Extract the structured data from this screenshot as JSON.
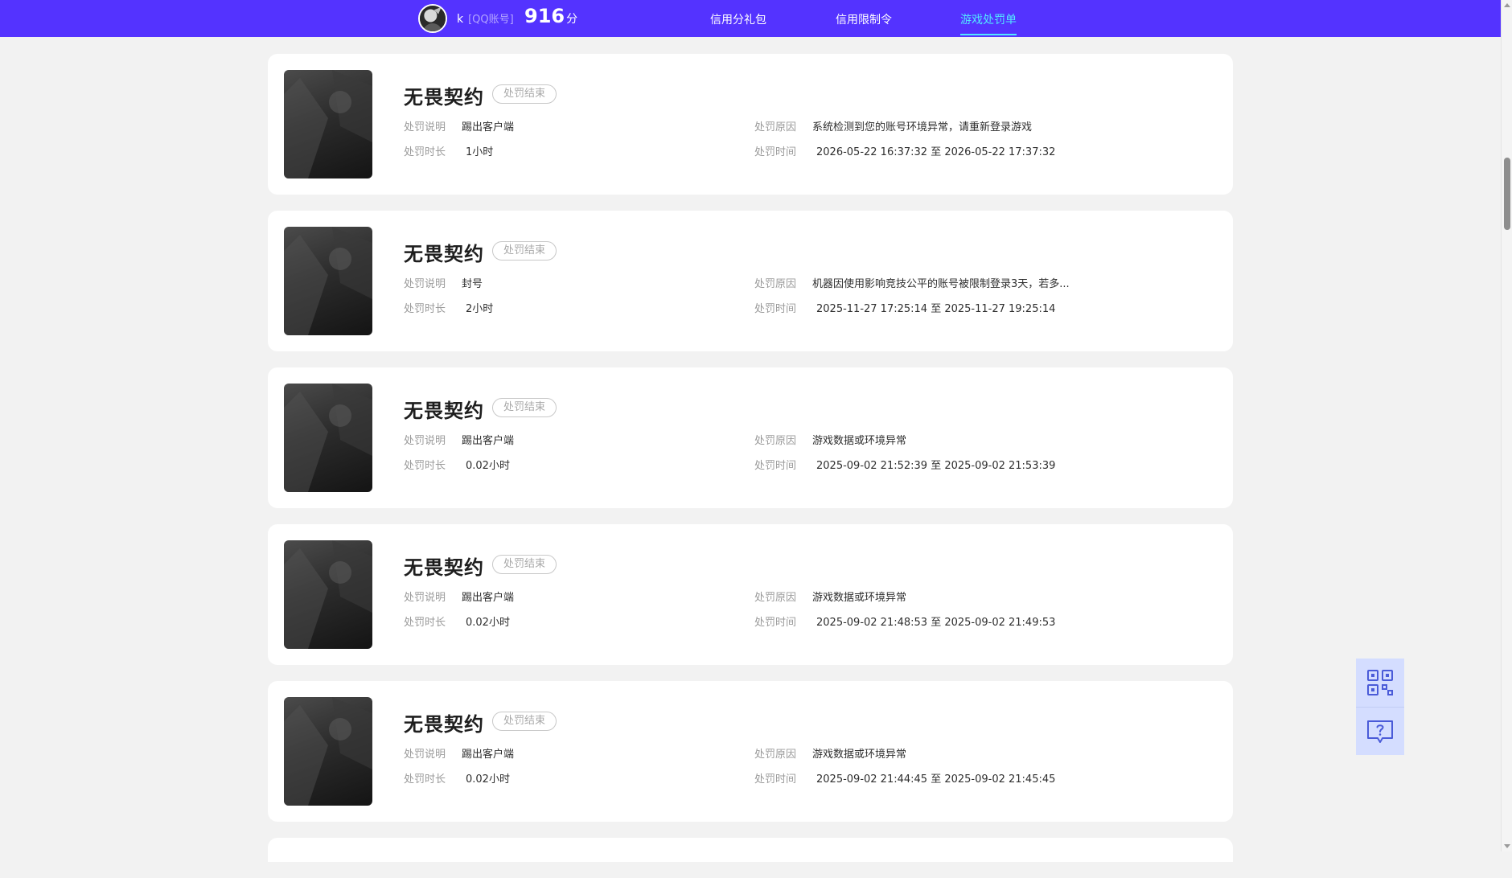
{
  "header": {
    "username": "k",
    "account_type": "[QQ账号]",
    "score": "916",
    "score_unit": "分",
    "tabs": [
      {
        "label": "信用分礼包",
        "active": false
      },
      {
        "label": "信用限制令",
        "active": false
      },
      {
        "label": "游戏处罚单",
        "active": true
      }
    ]
  },
  "labels": {
    "desc": "处罚说明",
    "duration": "处罚时长",
    "reason": "处罚原因",
    "time": "处罚时间"
  },
  "records": [
    {
      "game": "无畏契约",
      "status": "处罚结束",
      "desc": "踢出客户端",
      "duration": "1小时",
      "reason": "系统检测到您的账号环境异常，请重新登录游戏",
      "time": "2026-05-22 16:37:32 至 2026-05-22 17:37:32"
    },
    {
      "game": "无畏契约",
      "status": "处罚结束",
      "desc": "封号",
      "duration": "2小时",
      "reason": "机器因使用影响竞技公平的账号被限制登录3天，若多...",
      "time": "2025-11-27 17:25:14 至 2025-11-27 19:25:14"
    },
    {
      "game": "无畏契约",
      "status": "处罚结束",
      "desc": "踢出客户端",
      "duration": "0.02小时",
      "reason": "游戏数据或环境异常",
      "time": "2025-09-02 21:52:39 至 2025-09-02 21:53:39"
    },
    {
      "game": "无畏契约",
      "status": "处罚结束",
      "desc": "踢出客户端",
      "duration": "0.02小时",
      "reason": "游戏数据或环境异常",
      "time": "2025-09-02 21:48:53 至 2025-09-02 21:49:53"
    },
    {
      "game": "无畏契约",
      "status": "处罚结束",
      "desc": "踢出客户端",
      "duration": "0.02小时",
      "reason": "游戏数据或环境异常",
      "time": "2025-09-02 21:44:45 至 2025-09-02 21:45:45"
    }
  ],
  "floating_buttons": [
    {
      "icon": "qr-code-icon"
    },
    {
      "icon": "feedback-help-icon"
    }
  ],
  "colors": {
    "nav_background": "#5433ff",
    "nav_active": "#52e7ff",
    "page_background": "#f2f2f2",
    "float_button_background": "#d4ddff",
    "float_icon": "#4a5bd8"
  }
}
